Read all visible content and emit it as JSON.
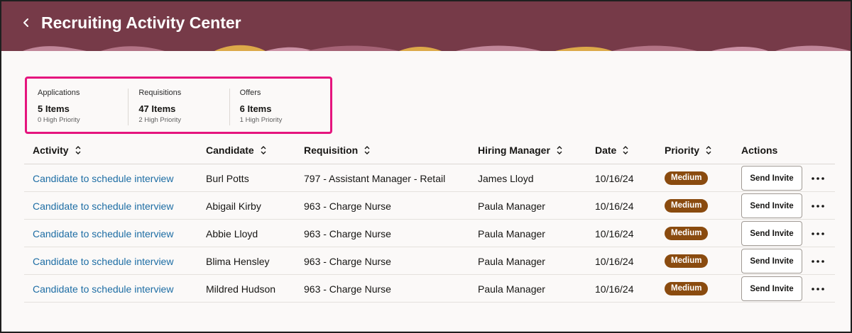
{
  "header": {
    "title": "Recruiting Activity Center",
    "back_icon": "chevron-left-icon",
    "background": "#763a48"
  },
  "summary": [
    {
      "label": "Applications",
      "count": "5 Items",
      "priority": "0 High Priority"
    },
    {
      "label": "Requisitions",
      "count": "47 Items",
      "priority": "2 High Priority"
    },
    {
      "label": "Offers",
      "count": "6 Items",
      "priority": "1 High Priority"
    }
  ],
  "table": {
    "columns": [
      "Activity",
      "Candidate",
      "Requisition",
      "Hiring Manager",
      "Date",
      "Priority",
      "Actions"
    ],
    "rows": [
      {
        "activity": "Candidate to schedule interview",
        "candidate": "Burl Potts",
        "requisition": "797 - Assistant Manager - Retail",
        "hiring_manager": "James Lloyd",
        "date": "10/16/24",
        "priority": "Medium",
        "action": "Send Invite"
      },
      {
        "activity": "Candidate to schedule interview",
        "candidate": "Abigail Kirby",
        "requisition": "963 - Charge Nurse",
        "hiring_manager": "Paula Manager",
        "date": "10/16/24",
        "priority": "Medium",
        "action": "Send Invite"
      },
      {
        "activity": "Candidate to schedule interview",
        "candidate": "Abbie Lloyd",
        "requisition": "963 - Charge Nurse",
        "hiring_manager": "Paula Manager",
        "date": "10/16/24",
        "priority": "Medium",
        "action": "Send Invite"
      },
      {
        "activity": "Candidate to schedule interview",
        "candidate": "Blima Hensley",
        "requisition": "963 - Charge Nurse",
        "hiring_manager": "Paula Manager",
        "date": "10/16/24",
        "priority": "Medium",
        "action": "Send Invite"
      },
      {
        "activity": "Candidate to schedule interview",
        "candidate": "Mildred Hudson",
        "requisition": "963 - Charge Nurse",
        "hiring_manager": "Paula Manager",
        "date": "10/16/24",
        "priority": "Medium",
        "action": "Send Invite"
      }
    ]
  },
  "colors": {
    "link": "#1d6da4",
    "badge": "#8a4b0f",
    "highlight_border": "#e5157e"
  }
}
